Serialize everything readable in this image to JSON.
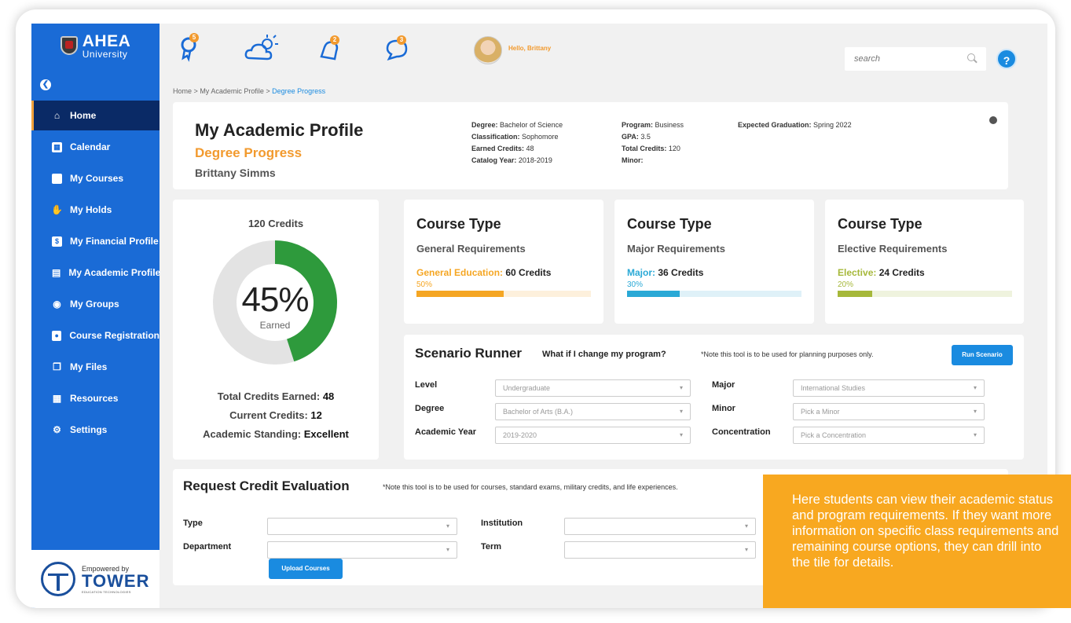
{
  "brand": {
    "name": "AHEA",
    "subtitle": "University",
    "footer_tagline": "Empowered by",
    "footer_name": "TOWER",
    "footer_sub": "EDUCATION TECHNOLOGIES"
  },
  "sidebar": {
    "items": [
      {
        "label": "Home",
        "icon": "home-icon"
      },
      {
        "label": "Calendar",
        "icon": "calendar-icon"
      },
      {
        "label": "My Courses",
        "icon": "book-icon"
      },
      {
        "label": "My Holds",
        "icon": "hold-icon"
      },
      {
        "label": "My Financial Profile",
        "icon": "dollar-icon"
      },
      {
        "label": "My Academic Profile",
        "icon": "profile-icon"
      },
      {
        "label": "My Groups",
        "icon": "groups-icon"
      },
      {
        "label": "Course Registration",
        "icon": "registration-icon"
      },
      {
        "label": "My Files",
        "icon": "files-icon"
      },
      {
        "label": "Resources",
        "icon": "resources-icon"
      },
      {
        "label": "Settings",
        "icon": "settings-icon"
      }
    ],
    "active": "Home"
  },
  "topbar": {
    "badges": {
      "awards": "5",
      "alerts": "2",
      "messages": "3"
    },
    "greeting": "Hello, Brittany",
    "search_placeholder": "search",
    "help": "?"
  },
  "breadcrumb": {
    "home": "Home",
    "sep": ">",
    "profile": "My Academic Profile",
    "current": "Degree Progress"
  },
  "profile": {
    "title": "My Academic Profile",
    "subtitle": "Degree Progress",
    "student_name": "Brittany Simms",
    "fields": {
      "degree_label": "Degree:",
      "degree": "Bachelor of Science",
      "classification_label": "Classification:",
      "classification": "Sophomore",
      "earned_label": "Earned Credits:",
      "earned": "48",
      "catalog_label": "Catalog Year:",
      "catalog": "2018-2019",
      "program_label": "Program:",
      "program": "Business",
      "gpa_label": "GPA:",
      "gpa": "3.5",
      "total_label": "Total Credits:",
      "total": "120",
      "minor_label": "Minor:",
      "minor": "",
      "grad_label": "Expected Graduation:",
      "grad": "Spring 2022"
    }
  },
  "credits": {
    "title": "120 Credits",
    "percent_label": "45%",
    "percent_value": 0.45,
    "earned_label": "Earned",
    "total_earned_label": "Total Credits Earned:",
    "total_earned": "48",
    "current_label": "Current Credits:",
    "current": "12",
    "standing_label": "Academic Standing:",
    "standing": "Excellent"
  },
  "course_types": [
    {
      "title": "Course Type",
      "subtitle": "General Requirements",
      "req_name": "General Education:",
      "req_credits": "60 Credits",
      "pct_label": "50%",
      "pct": 0.5,
      "color": "#f5a623",
      "track": "#fdf0dc"
    },
    {
      "title": "Course Type",
      "subtitle": "Major Requirements",
      "req_name": "Major:",
      "req_credits": "36 Credits",
      "pct_label": "30%",
      "pct": 0.3,
      "color": "#2aa9d6",
      "track": "#dff1f8"
    },
    {
      "title": "Course Type",
      "subtitle": "Elective Requirements",
      "req_name": "Elective:",
      "req_credits": "24 Credits",
      "pct_label": "20%",
      "pct": 0.2,
      "color": "#a6b83a",
      "track": "#eff3de"
    }
  ],
  "scenario": {
    "title": "Scenario Runner",
    "question": "What if I change my program?",
    "note": "*Note this tool is to be used for planning purposes only.",
    "run_button": "Run Scenario",
    "fields": {
      "level_label": "Level",
      "level": "Undergraduate",
      "degree_label": "Degree",
      "degree": "Bachelor of Arts (B.A.)",
      "year_label": "Academic Year",
      "year": "2019-2020",
      "major_label": "Major",
      "major": "International Studies",
      "minor_label": "Minor",
      "minor": "Pick a Minor",
      "concentration_label": "Concentration",
      "concentration": "Pick a Concentration"
    }
  },
  "credit_eval": {
    "title": "Request Credit Evaluation",
    "note": "*Note this tool is to be used for courses, standard exams, military credits, and life experiences.",
    "type_label": "Type",
    "department_label": "Department",
    "institution_label": "Institution",
    "term_label": "Term",
    "upload_button": "Upload Courses"
  },
  "callout": "Here students can view their academic status and program requirements. If they want more information on specific class requirements and remaining course options, they can drill into the tile for details.",
  "colors": {
    "primary": "#1a6bd6",
    "accent": "#f29a2e",
    "donut": "#2e9a3c",
    "donut_track": "#e3e3e3",
    "callout": "#f8a820"
  }
}
